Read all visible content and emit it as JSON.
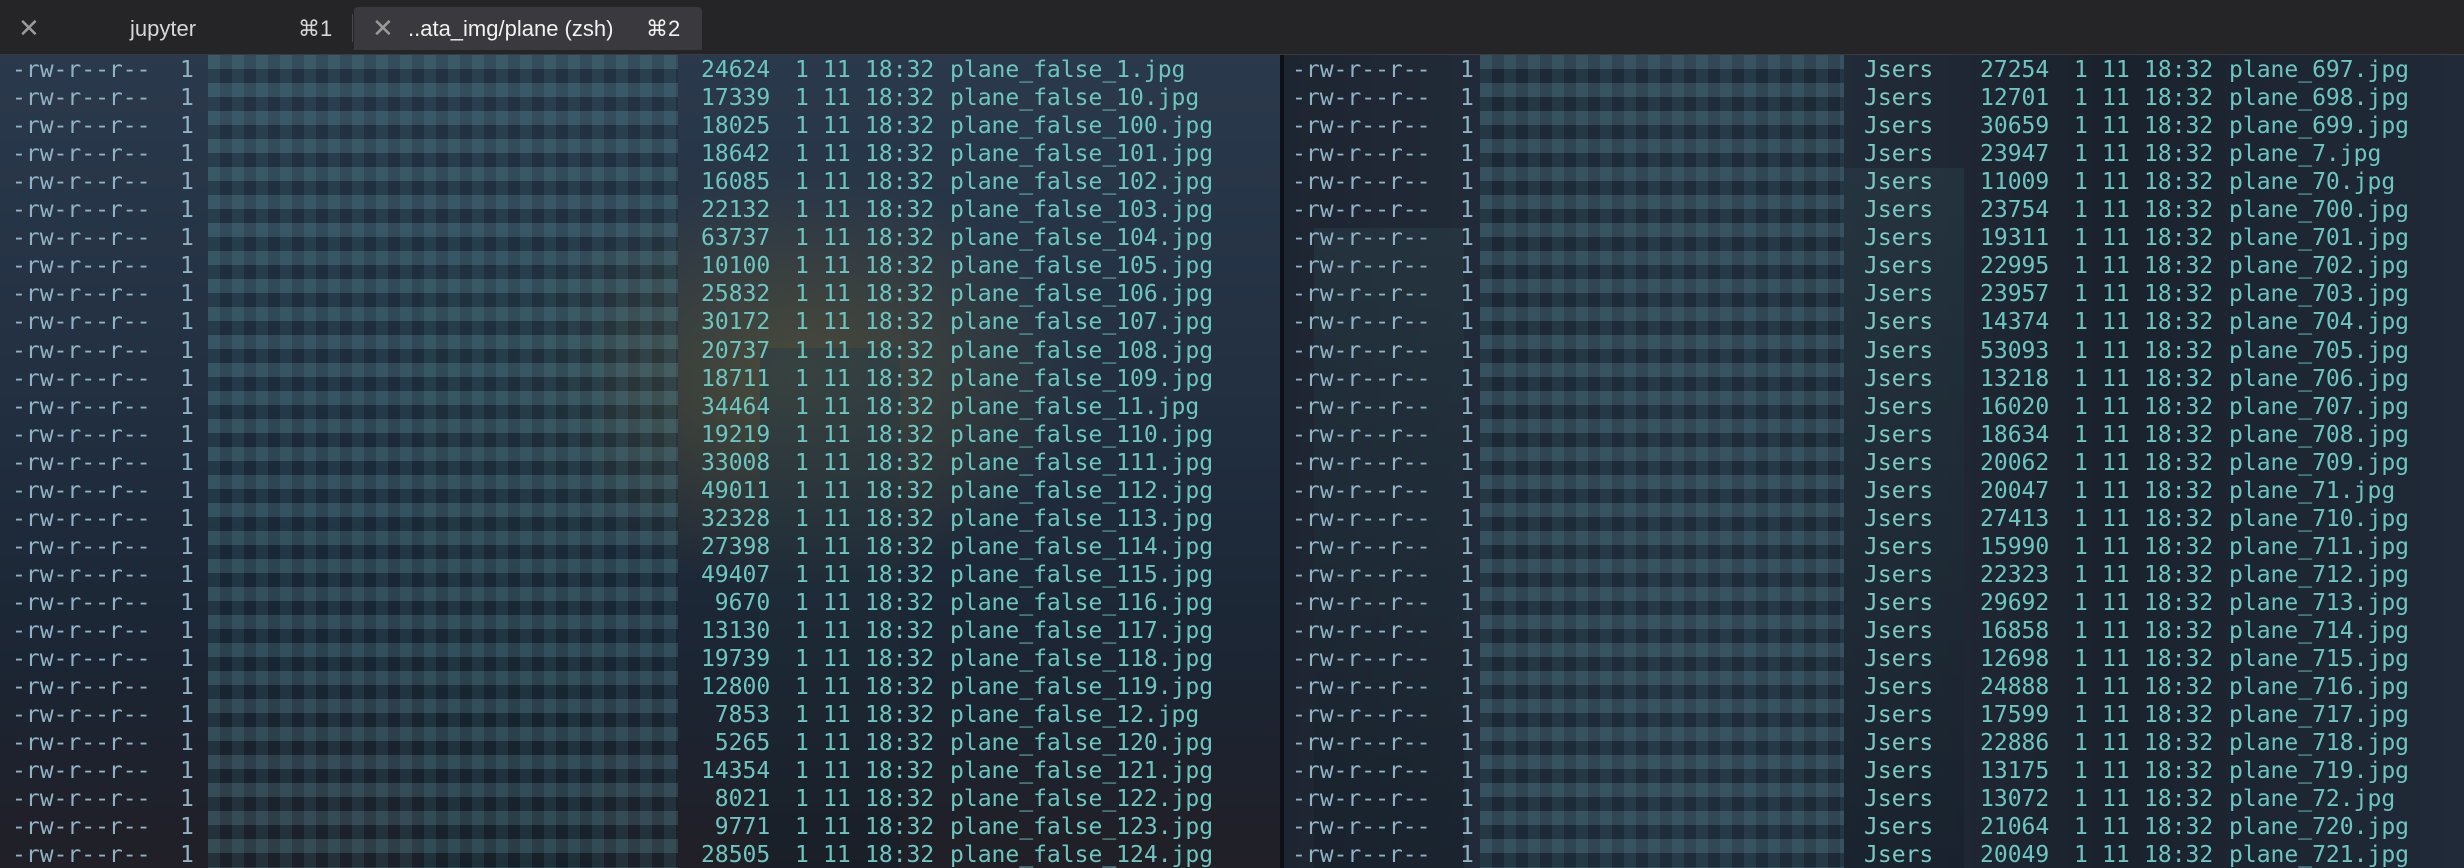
{
  "tabs": [
    {
      "close_glyph": "✕",
      "title": "jupyter",
      "shortcut": "⌘1"
    },
    {
      "close_glyph": "✕",
      "title": "..ata_img/plane (zsh)",
      "shortcut": "⌘2"
    }
  ],
  "left_pane": {
    "rows": [
      {
        "perm": "-rw-r--r--",
        "links": "1",
        "size": "24624",
        "month": "1",
        "day": "11",
        "time": "18:32",
        "name": "plane_false_1.jpg"
      },
      {
        "perm": "-rw-r--r--",
        "links": "1",
        "size": "17339",
        "month": "1",
        "day": "11",
        "time": "18:32",
        "name": "plane_false_10.jpg"
      },
      {
        "perm": "-rw-r--r--",
        "links": "1",
        "size": "18025",
        "month": "1",
        "day": "11",
        "time": "18:32",
        "name": "plane_false_100.jpg"
      },
      {
        "perm": "-rw-r--r--",
        "links": "1",
        "size": "18642",
        "month": "1",
        "day": "11",
        "time": "18:32",
        "name": "plane_false_101.jpg"
      },
      {
        "perm": "-rw-r--r--",
        "links": "1",
        "size": "16085",
        "month": "1",
        "day": "11",
        "time": "18:32",
        "name": "plane_false_102.jpg"
      },
      {
        "perm": "-rw-r--r--",
        "links": "1",
        "size": "22132",
        "month": "1",
        "day": "11",
        "time": "18:32",
        "name": "plane_false_103.jpg"
      },
      {
        "perm": "-rw-r--r--",
        "links": "1",
        "size": "63737",
        "month": "1",
        "day": "11",
        "time": "18:32",
        "name": "plane_false_104.jpg"
      },
      {
        "perm": "-rw-r--r--",
        "links": "1",
        "size": "10100",
        "month": "1",
        "day": "11",
        "time": "18:32",
        "name": "plane_false_105.jpg"
      },
      {
        "perm": "-rw-r--r--",
        "links": "1",
        "size": "25832",
        "month": "1",
        "day": "11",
        "time": "18:32",
        "name": "plane_false_106.jpg"
      },
      {
        "perm": "-rw-r--r--",
        "links": "1",
        "size": "30172",
        "month": "1",
        "day": "11",
        "time": "18:32",
        "name": "plane_false_107.jpg"
      },
      {
        "perm": "-rw-r--r--",
        "links": "1",
        "size": "20737",
        "month": "1",
        "day": "11",
        "time": "18:32",
        "name": "plane_false_108.jpg"
      },
      {
        "perm": "-rw-r--r--",
        "links": "1",
        "size": "18711",
        "month": "1",
        "day": "11",
        "time": "18:32",
        "name": "plane_false_109.jpg"
      },
      {
        "perm": "-rw-r--r--",
        "links": "1",
        "size": "34464",
        "month": "1",
        "day": "11",
        "time": "18:32",
        "name": "plane_false_11.jpg"
      },
      {
        "perm": "-rw-r--r--",
        "links": "1",
        "size": "19219",
        "month": "1",
        "day": "11",
        "time": "18:32",
        "name": "plane_false_110.jpg"
      },
      {
        "perm": "-rw-r--r--",
        "links": "1",
        "size": "33008",
        "month": "1",
        "day": "11",
        "time": "18:32",
        "name": "plane_false_111.jpg"
      },
      {
        "perm": "-rw-r--r--",
        "links": "1",
        "size": "49011",
        "month": "1",
        "day": "11",
        "time": "18:32",
        "name": "plane_false_112.jpg"
      },
      {
        "perm": "-rw-r--r--",
        "links": "1",
        "size": "32328",
        "month": "1",
        "day": "11",
        "time": "18:32",
        "name": "plane_false_113.jpg"
      },
      {
        "perm": "-rw-r--r--",
        "links": "1",
        "size": "27398",
        "month": "1",
        "day": "11",
        "time": "18:32",
        "name": "plane_false_114.jpg"
      },
      {
        "perm": "-rw-r--r--",
        "links": "1",
        "size": "49407",
        "month": "1",
        "day": "11",
        "time": "18:32",
        "name": "plane_false_115.jpg"
      },
      {
        "perm": "-rw-r--r--",
        "links": "1",
        "size": "9670",
        "month": "1",
        "day": "11",
        "time": "18:32",
        "name": "plane_false_116.jpg"
      },
      {
        "perm": "-rw-r--r--",
        "links": "1",
        "size": "13130",
        "month": "1",
        "day": "11",
        "time": "18:32",
        "name": "plane_false_117.jpg"
      },
      {
        "perm": "-rw-r--r--",
        "links": "1",
        "size": "19739",
        "month": "1",
        "day": "11",
        "time": "18:32",
        "name": "plane_false_118.jpg"
      },
      {
        "perm": "-rw-r--r--",
        "links": "1",
        "size": "12800",
        "month": "1",
        "day": "11",
        "time": "18:32",
        "name": "plane_false_119.jpg"
      },
      {
        "perm": "-rw-r--r--",
        "links": "1",
        "size": "7853",
        "month": "1",
        "day": "11",
        "time": "18:32",
        "name": "plane_false_12.jpg"
      },
      {
        "perm": "-rw-r--r--",
        "links": "1",
        "size": "5265",
        "month": "1",
        "day": "11",
        "time": "18:32",
        "name": "plane_false_120.jpg"
      },
      {
        "perm": "-rw-r--r--",
        "links": "1",
        "size": "14354",
        "month": "1",
        "day": "11",
        "time": "18:32",
        "name": "plane_false_121.jpg"
      },
      {
        "perm": "-rw-r--r--",
        "links": "1",
        "size": "8021",
        "month": "1",
        "day": "11",
        "time": "18:32",
        "name": "plane_false_122.jpg"
      },
      {
        "perm": "-rw-r--r--",
        "links": "1",
        "size": "9771",
        "month": "1",
        "day": "11",
        "time": "18:32",
        "name": "plane_false_123.jpg"
      },
      {
        "perm": "-rw-r--r--",
        "links": "1",
        "size": "28505",
        "month": "1",
        "day": "11",
        "time": "18:32",
        "name": "plane_false_124.jpg"
      }
    ]
  },
  "right_pane": {
    "rows": [
      {
        "perm": "-rw-r--r--",
        "links": "1",
        "owner": "Jsers",
        "size": "27254",
        "month": "1",
        "day": "11",
        "time": "18:32",
        "name": "plane_697.jpg"
      },
      {
        "perm": "-rw-r--r--",
        "links": "1",
        "owner": "Jsers",
        "size": "12701",
        "month": "1",
        "day": "11",
        "time": "18:32",
        "name": "plane_698.jpg"
      },
      {
        "perm": "-rw-r--r--",
        "links": "1",
        "owner": "Jsers",
        "size": "30659",
        "month": "1",
        "day": "11",
        "time": "18:32",
        "name": "plane_699.jpg"
      },
      {
        "perm": "-rw-r--r--",
        "links": "1",
        "owner": "Jsers",
        "size": "23947",
        "month": "1",
        "day": "11",
        "time": "18:32",
        "name": "plane_7.jpg"
      },
      {
        "perm": "-rw-r--r--",
        "links": "1",
        "owner": "Jsers",
        "size": "11009",
        "month": "1",
        "day": "11",
        "time": "18:32",
        "name": "plane_70.jpg"
      },
      {
        "perm": "-rw-r--r--",
        "links": "1",
        "owner": "Jsers",
        "size": "23754",
        "month": "1",
        "day": "11",
        "time": "18:32",
        "name": "plane_700.jpg"
      },
      {
        "perm": "-rw-r--r--",
        "links": "1",
        "owner": "Jsers",
        "size": "19311",
        "month": "1",
        "day": "11",
        "time": "18:32",
        "name": "plane_701.jpg"
      },
      {
        "perm": "-rw-r--r--",
        "links": "1",
        "owner": "Jsers",
        "size": "22995",
        "month": "1",
        "day": "11",
        "time": "18:32",
        "name": "plane_702.jpg"
      },
      {
        "perm": "-rw-r--r--",
        "links": "1",
        "owner": "Jsers",
        "size": "23957",
        "month": "1",
        "day": "11",
        "time": "18:32",
        "name": "plane_703.jpg"
      },
      {
        "perm": "-rw-r--r--",
        "links": "1",
        "owner": "Jsers",
        "size": "14374",
        "month": "1",
        "day": "11",
        "time": "18:32",
        "name": "plane_704.jpg"
      },
      {
        "perm": "-rw-r--r--",
        "links": "1",
        "owner": "Jsers",
        "size": "53093",
        "month": "1",
        "day": "11",
        "time": "18:32",
        "name": "plane_705.jpg"
      },
      {
        "perm": "-rw-r--r--",
        "links": "1",
        "owner": "Jsers",
        "size": "13218",
        "month": "1",
        "day": "11",
        "time": "18:32",
        "name": "plane_706.jpg"
      },
      {
        "perm": "-rw-r--r--",
        "links": "1",
        "owner": "Jsers",
        "size": "16020",
        "month": "1",
        "day": "11",
        "time": "18:32",
        "name": "plane_707.jpg"
      },
      {
        "perm": "-rw-r--r--",
        "links": "1",
        "owner": "Jsers",
        "size": "18634",
        "month": "1",
        "day": "11",
        "time": "18:32",
        "name": "plane_708.jpg"
      },
      {
        "perm": "-rw-r--r--",
        "links": "1",
        "owner": "Jsers",
        "size": "20062",
        "month": "1",
        "day": "11",
        "time": "18:32",
        "name": "plane_709.jpg"
      },
      {
        "perm": "-rw-r--r--",
        "links": "1",
        "owner": "Jsers",
        "size": "20047",
        "month": "1",
        "day": "11",
        "time": "18:32",
        "name": "plane_71.jpg"
      },
      {
        "perm": "-rw-r--r--",
        "links": "1",
        "owner": "Jsers",
        "size": "27413",
        "month": "1",
        "day": "11",
        "time": "18:32",
        "name": "plane_710.jpg"
      },
      {
        "perm": "-rw-r--r--",
        "links": "1",
        "owner": "Jsers",
        "size": "15990",
        "month": "1",
        "day": "11",
        "time": "18:32",
        "name": "plane_711.jpg"
      },
      {
        "perm": "-rw-r--r--",
        "links": "1",
        "owner": "Jsers",
        "size": "22323",
        "month": "1",
        "day": "11",
        "time": "18:32",
        "name": "plane_712.jpg"
      },
      {
        "perm": "-rw-r--r--",
        "links": "1",
        "owner": "Jsers",
        "size": "29692",
        "month": "1",
        "day": "11",
        "time": "18:32",
        "name": "plane_713.jpg"
      },
      {
        "perm": "-rw-r--r--",
        "links": "1",
        "owner": "Jsers",
        "size": "16858",
        "month": "1",
        "day": "11",
        "time": "18:32",
        "name": "plane_714.jpg"
      },
      {
        "perm": "-rw-r--r--",
        "links": "1",
        "owner": "Jsers",
        "size": "12698",
        "month": "1",
        "day": "11",
        "time": "18:32",
        "name": "plane_715.jpg"
      },
      {
        "perm": "-rw-r--r--",
        "links": "1",
        "owner": "Jsers",
        "size": "24888",
        "month": "1",
        "day": "11",
        "time": "18:32",
        "name": "plane_716.jpg"
      },
      {
        "perm": "-rw-r--r--",
        "links": "1",
        "owner": "Jsers",
        "size": "17599",
        "month": "1",
        "day": "11",
        "time": "18:32",
        "name": "plane_717.jpg"
      },
      {
        "perm": "-rw-r--r--",
        "links": "1",
        "owner": "Jsers",
        "size": "22886",
        "month": "1",
        "day": "11",
        "time": "18:32",
        "name": "plane_718.jpg"
      },
      {
        "perm": "-rw-r--r--",
        "links": "1",
        "owner": "Jsers",
        "size": "13175",
        "month": "1",
        "day": "11",
        "time": "18:32",
        "name": "plane_719.jpg"
      },
      {
        "perm": "-rw-r--r--",
        "links": "1",
        "owner": "Jsers",
        "size": "13072",
        "month": "1",
        "day": "11",
        "time": "18:32",
        "name": "plane_72.jpg"
      },
      {
        "perm": "-rw-r--r--",
        "links": "1",
        "owner": "Jsers",
        "size": "21064",
        "month": "1",
        "day": "11",
        "time": "18:32",
        "name": "plane_720.jpg"
      },
      {
        "perm": "-rw-r--r--",
        "links": "1",
        "owner": "Jsers",
        "size": "20049",
        "month": "1",
        "day": "11",
        "time": "18:32",
        "name": "plane_721.jpg"
      }
    ]
  }
}
